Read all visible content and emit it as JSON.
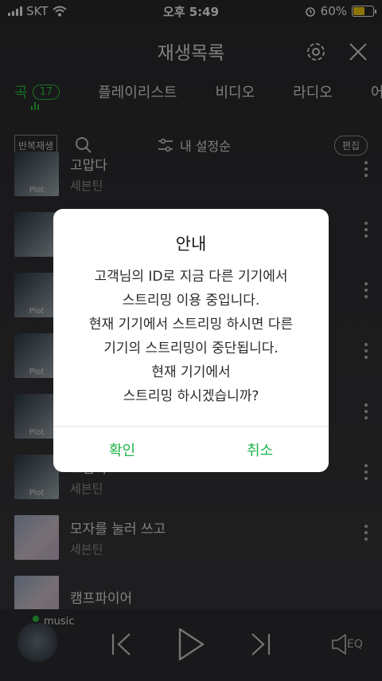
{
  "status": {
    "carrier": "SKT",
    "time": "오후 5:49",
    "battery": "60%",
    "battery_level": 0.6
  },
  "header": {
    "title": "재생목록"
  },
  "tabs": [
    {
      "label": "곡",
      "count": "17"
    },
    {
      "label": "플레이리스트"
    },
    {
      "label": "비디오"
    },
    {
      "label": "라디오"
    },
    {
      "label": "어학"
    }
  ],
  "toolbar": {
    "repeat": "반복재생",
    "sort": "내 설정순",
    "edit": "편집"
  },
  "songs": [
    {
      "title": "고맙다",
      "artist": "세븐틴",
      "thumb": "Plot"
    },
    {
      "title": "",
      "artist": "",
      "thumb": ""
    },
    {
      "title": "",
      "artist": "",
      "thumb": "Plot"
    },
    {
      "title": "",
      "artist": "",
      "thumb": "Plot"
    },
    {
      "title": "",
      "artist": "",
      "thumb": "Plot"
    },
    {
      "title": "고맙다",
      "artist": "세븐틴",
      "thumb": "Plot"
    },
    {
      "title": "모자를 눌러 쓰고",
      "artist": "세븐틴",
      "thumb": ""
    },
    {
      "title": "캠프파이어",
      "artist": "",
      "thumb": ""
    }
  ],
  "player": {
    "label": "music",
    "eq": "EQ"
  },
  "dialog": {
    "title": "안내",
    "lines": [
      "고객님의 ID로 지금 다른 기기에서",
      "스트리밍 이용 중입니다.",
      "현재 기기에서 스트리밍 하시면 다른",
      "기기의 스트리밍이 중단됩니다.",
      "현재 기기에서",
      "스트리밍 하시겠습니까?"
    ],
    "confirm": "확인",
    "cancel": "취소"
  },
  "colors": {
    "accent": "#2ecc40",
    "battery_fill": "#ffd60a"
  }
}
